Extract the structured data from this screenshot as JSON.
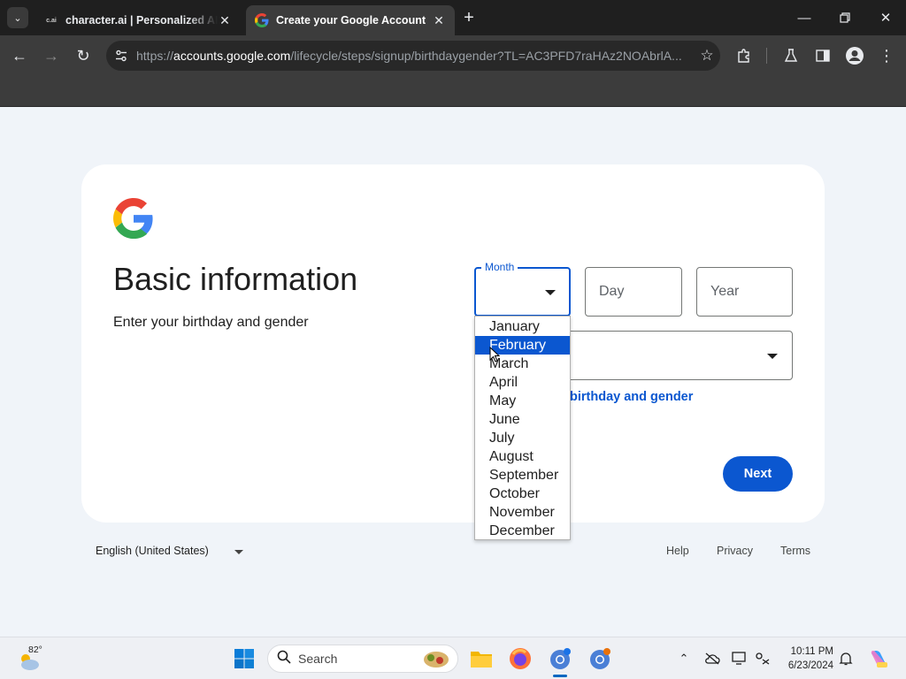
{
  "browser": {
    "tabs": [
      {
        "label": "character.ai | Personalized AI for",
        "favicon": "c.ai",
        "active": false
      },
      {
        "label": "Create your Google Account",
        "favicon": "google-g-icon",
        "active": true
      }
    ],
    "url_prefix": "https://",
    "url_host": "accounts.google.com",
    "url_path": "/lifecycle/steps/signup/birthdaygender?TL=AC3PFD7raHAz2NOAbrlA..."
  },
  "page": {
    "heading": "Basic information",
    "subheading": "Enter your birthday and gender",
    "month_label": "Month",
    "day_placeholder": "Day",
    "year_placeholder": "Year",
    "why_link": "birthday and gender",
    "next_label": "Next"
  },
  "month_dropdown": {
    "options": [
      "January",
      "February",
      "March",
      "April",
      "May",
      "June",
      "July",
      "August",
      "September",
      "October",
      "November",
      "December"
    ],
    "highlighted": "February"
  },
  "footer": {
    "language": "English (United States)",
    "links": [
      "Help",
      "Privacy",
      "Terms"
    ]
  },
  "taskbar": {
    "temperature": "82°",
    "search_placeholder": "Search",
    "time": "10:11 PM",
    "date": "6/23/2024"
  },
  "colors": {
    "accent": "#0b57d0",
    "page_bg": "#f0f4f9",
    "chrome_dark": "#1f1f1f"
  }
}
